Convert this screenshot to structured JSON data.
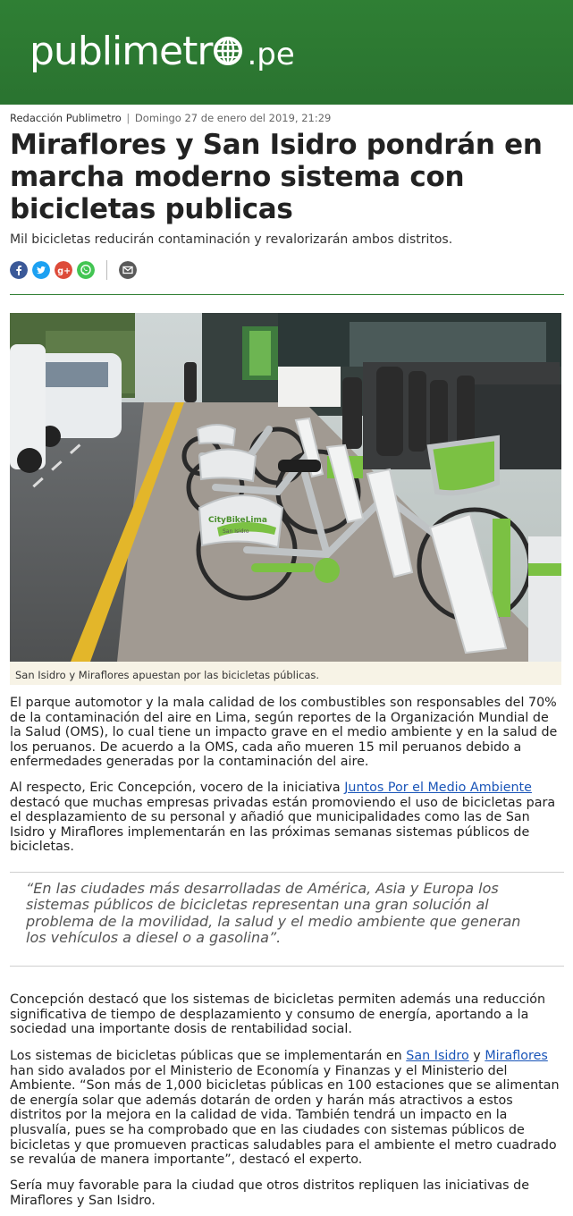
{
  "site": {
    "logo_main": "publimetr",
    "logo_tld": ".pe",
    "brand_color": "#2e7d32"
  },
  "article": {
    "author": "Redacción Publimetro",
    "separator": "|",
    "date": "Domingo 27 de enero del 2019, 21:29",
    "title": "Miraflores y San Isidro pondrán en marcha moderno sistema con bicicletas publicas",
    "subtitle": "Mil bicicletas reducirán contaminación y revalorizarán ambos distritos."
  },
  "share": {
    "icons": [
      "facebook-icon",
      "twitter-icon",
      "google-plus-icon",
      "whatsapp-icon",
      "email-icon"
    ]
  },
  "photo": {
    "caption": "San Isidro y Miraflores apuestan por las bicicletas públicas.",
    "bike_brand": "CityBikeLima",
    "bike_sub": "San Isidro"
  },
  "body": {
    "p1": "El parque automotor y la mala calidad de los combustibles son responsables del 70% de la contaminación del aire en Lima, según reportes de la Organización Mundial de la Salud (OMS), lo cual tiene un impacto grave en el medio ambiente y en la salud de los peruanos. De acuerdo a la OMS, cada año mueren 15 mil peruanos debido a enfermedades generadas por la contaminación del aire.",
    "p2_a": "Al respecto, Eric Concepción, vocero de la iniciativa ",
    "p2_link": "Juntos Por el Medio Ambiente",
    "p2_b": " destacó que muchas empresas privadas están promoviendo el uso de bicicletas para el desplazamiento de su personal y añadió que municipalidades como las de San Isidro y Miraflores implementarán en las próximas semanas sistemas públicos de bicicletas.",
    "quote": "“En las ciudades más desarrolladas de América, Asia y Europa los sistemas públicos de bicicletas representan una gran solución al problema de la movilidad, la salud y el medio ambiente que generan los vehículos a diesel o a gasolina”.",
    "p3": "Concepción destacó que los sistemas de bicicletas permiten además una reducción significativa de tiempo de desplazamiento y consumo de energía, aportando a la sociedad una importante dosis de rentabilidad social.",
    "p4_a": "Los sistemas de bicicletas públicas que se implementarán en ",
    "p4_link1": "San Isidro",
    "p4_b": " y ",
    "p4_link2": "Miraflores",
    "p4_c": " han sido avalados por el Ministerio de Economía y Finanzas y el Ministerio del Ambiente. “Son más de 1,000 bicicletas públicas en 100 estaciones que se alimentan de energía solar que además dotarán de orden y harán más atractivos a estos distritos por la mejora en la calidad de vida. También tendrá un impacto en la plusvalía, pues se ha comprobado que en las ciudades con sistemas públicos de bicicletas y que promueven practicas saludables para el ambiente el metro cuadrado se revalúa de manera importante”, destacó el experto.",
    "p5": "Sería muy favorable para la ciudad que otros distritos repliquen las iniciativas de Miraflores y San Isidro."
  }
}
